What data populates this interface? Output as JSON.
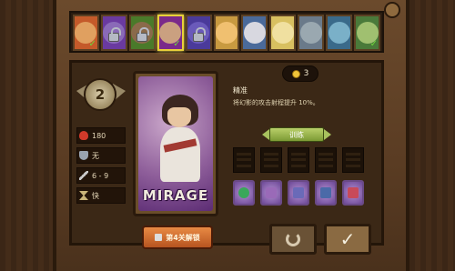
{
  "portraits": [
    {
      "id": "p1",
      "color": "#c45a2a",
      "face": "#e0a060",
      "locked": false,
      "check": true
    },
    {
      "id": "p2",
      "color": "#6a3aa0",
      "face": "#8a6ab8",
      "locked": true,
      "check": false
    },
    {
      "id": "p3",
      "color": "#4a7a2a",
      "face": "#8a6a4a",
      "locked": true,
      "check": false
    },
    {
      "id": "p4",
      "color": "#7a2a8a",
      "face": "#caa080",
      "locked": false,
      "check": true
    },
    {
      "id": "p5",
      "color": "#4a3a9a",
      "face": "#6a5aba",
      "locked": true,
      "check": false
    },
    {
      "id": "p6",
      "color": "#c89a40",
      "face": "#f0c070",
      "locked": false,
      "check": false
    },
    {
      "id": "p7",
      "color": "#4a6a9a",
      "face": "#d8d8e0",
      "locked": false,
      "check": false
    },
    {
      "id": "p8",
      "color": "#d8c060",
      "face": "#f0e0a0",
      "locked": false,
      "check": false
    },
    {
      "id": "p9",
      "color": "#6a7a8a",
      "face": "#9aa8b0",
      "locked": false,
      "check": false
    },
    {
      "id": "p10",
      "color": "#3a6a8a",
      "face": "#7ab0c8",
      "locked": false,
      "check": false
    },
    {
      "id": "p11",
      "color": "#4a7a3a",
      "face": "#a0c070",
      "locked": false,
      "check": true
    }
  ],
  "hero": {
    "level": "2",
    "name": "MIRAGE",
    "stats": {
      "health": "180",
      "armor": "无",
      "damage": "6 - 9",
      "speed": "快"
    }
  },
  "skill": {
    "cost": "3",
    "title": "精准",
    "description": "将幻影的攻击射程提升 10%。"
  },
  "buttons": {
    "train": "训练",
    "unlock": "第4关解锁",
    "confirm": "✓"
  },
  "skills": [
    {
      "id": "s1",
      "color": "#3aa85a"
    },
    {
      "id": "s2",
      "color": "#9a6ab8"
    },
    {
      "id": "s3",
      "color": "#6a6ab8"
    },
    {
      "id": "s4",
      "color": "#4a6aa8"
    },
    {
      "id": "s5",
      "color": "#c84a5a"
    }
  ]
}
